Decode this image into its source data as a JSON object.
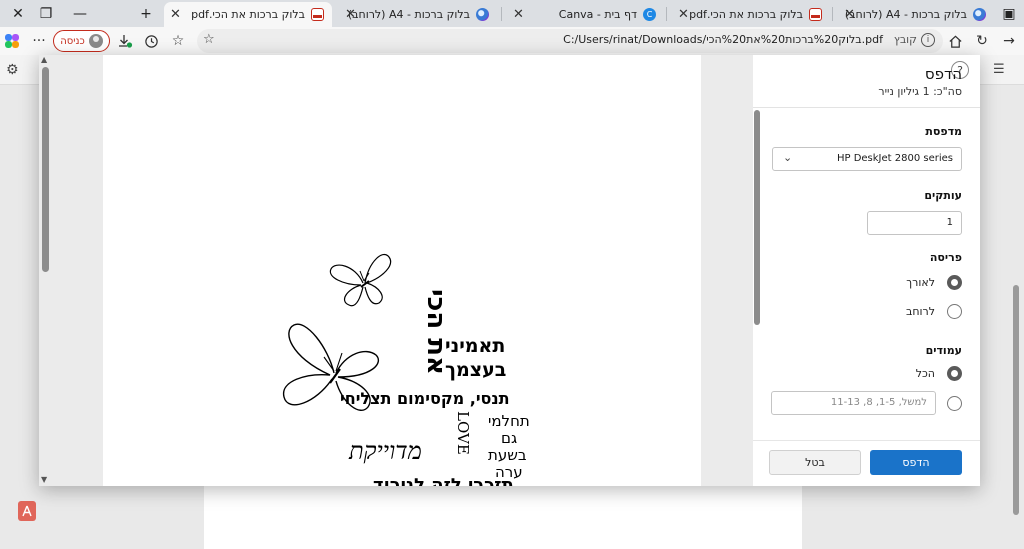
{
  "tabs": [
    {
      "label": "בלוק ברכות - A4 (לרוחב)",
      "icon": "colorful-page-icon"
    },
    {
      "label": "בלוק ברכות את הכי.pdf",
      "icon": "pdf-file-icon"
    },
    {
      "label": "דף בית - Canva",
      "icon": "canva-icon"
    },
    {
      "label": "בלוק ברכות - A4 (לרוחב)",
      "icon": "colorful-page-icon"
    },
    {
      "label": "בלוק ברכות את הכי.pdf",
      "icon": "pdf-file-icon"
    }
  ],
  "addressbar": {
    "file_label": "קובץ",
    "url": "C:/Users/rinat/Downloads/בלוק%20ברכות%20את%20הכי.pdf",
    "signin_label": "כניסה"
  },
  "print": {
    "title": "הדפס",
    "subtitle": "סה\"כ: 1 גיליון נייר",
    "help": "?",
    "printer_label": "מדפסת",
    "printer_value": "HP DeskJet 2800 series",
    "copies_label": "עותקים",
    "copies_value": "1",
    "layout_label": "פריסה",
    "layout_portrait": "לאורך",
    "layout_landscape": "לרוחב",
    "pages_label": "עמודים",
    "pages_all": "הכל",
    "pages_placeholder": "למשל, 1-5, 8, 11-13",
    "print_button": "הדפס",
    "cancel_button": "בטל"
  },
  "artwork": {
    "vertical_main": "את הכי",
    "line1": "תאמיני",
    "line2": "בעצמך",
    "line3": "תנסי, מקסימום תצליחי",
    "love": "LOVE",
    "line4": "תחלמי",
    "line5": "גם",
    "line6": "בשעת",
    "line7": "ערה",
    "script_word": "מדוייקת",
    "cut_line": "תזכרי לזה לנירוד"
  },
  "colors": {
    "accent": "#1a73c9",
    "signin": "#c42b1c"
  }
}
